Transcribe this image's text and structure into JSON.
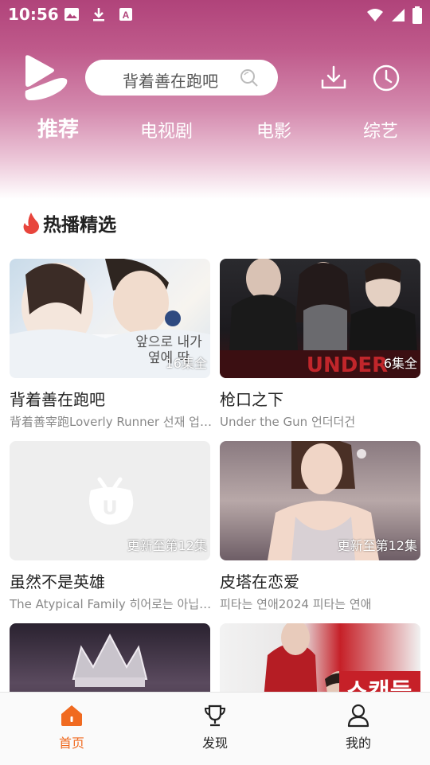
{
  "status_bar": {
    "time": "10:56"
  },
  "search": {
    "placeholder": "背着善在跑吧"
  },
  "tabs": [
    {
      "label": "推荐",
      "active": true
    },
    {
      "label": "电视剧",
      "active": false
    },
    {
      "label": "电影",
      "active": false
    },
    {
      "label": "综艺",
      "active": false
    }
  ],
  "section": {
    "title": "热播精选",
    "icon": "flame-icon"
  },
  "cards": [
    {
      "title": "背着善在跑吧",
      "subtitle": "背着善宰跑Loverly Runner 선재 업…",
      "badge": "16集全"
    },
    {
      "title": "枪口之下",
      "subtitle": "Under the Gun 언더더건",
      "badge": "6集全"
    },
    {
      "title": "虽然不是英雄",
      "subtitle": "The Atypical Family 히어로는 아닙…",
      "badge": "更新至第12集"
    },
    {
      "title": "皮塔在恋爱",
      "subtitle": "피타는 연애2024 피타는 연애",
      "badge": "更新至第12集"
    },
    {
      "title": "",
      "subtitle": "",
      "badge": ""
    },
    {
      "title": "",
      "subtitle": "",
      "badge": ""
    }
  ],
  "bottom_nav": [
    {
      "label": "首页",
      "icon": "home-icon",
      "active": true
    },
    {
      "label": "发现",
      "icon": "trophy-icon",
      "active": false
    },
    {
      "label": "我的",
      "icon": "user-icon",
      "active": false
    }
  ],
  "colors": {
    "accent": "#f06a20",
    "header_gradient_top": "#b0437a",
    "flame": "#e8453c"
  }
}
